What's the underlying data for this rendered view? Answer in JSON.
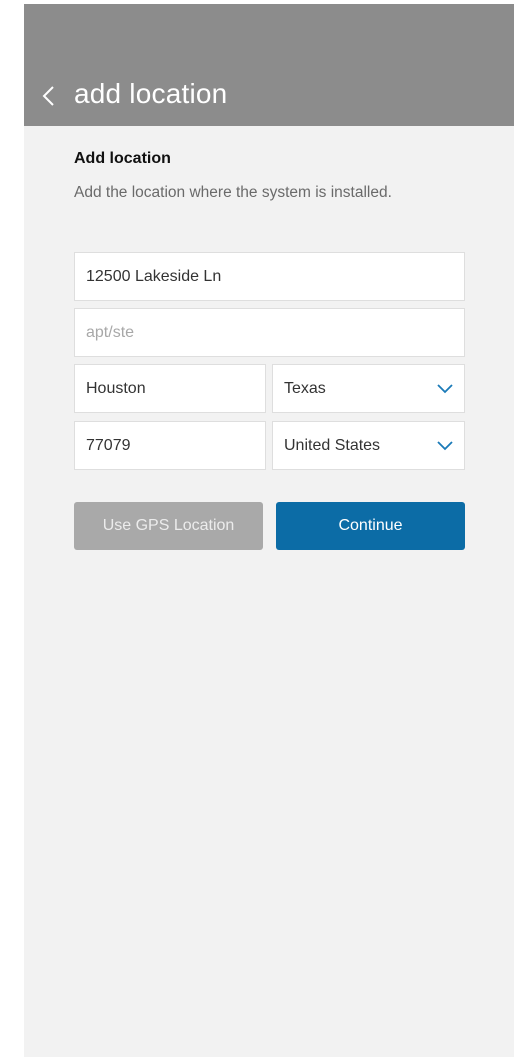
{
  "header": {
    "title": "add location",
    "back_icon": "chevron-left-icon"
  },
  "section": {
    "heading": "Add location",
    "description": "Add the location where the system is installed."
  },
  "form": {
    "street": {
      "value": "12500 Lakeside Ln"
    },
    "apt": {
      "value": "",
      "placeholder": "apt/ste"
    },
    "city": {
      "value": "Houston"
    },
    "state": {
      "value": "Texas",
      "icon": "chevron-down-icon"
    },
    "zip": {
      "value": "77079"
    },
    "country": {
      "value": "United States",
      "icon": "chevron-down-icon"
    }
  },
  "actions": {
    "gps_label": "Use GPS Location",
    "continue_label": "Continue"
  },
  "colors": {
    "header_bg": "#8c8c8c",
    "page_bg": "#f2f2f2",
    "primary": "#0c6ca6",
    "disabled": "#a9a9a9",
    "chevron": "#1a7ab8"
  }
}
